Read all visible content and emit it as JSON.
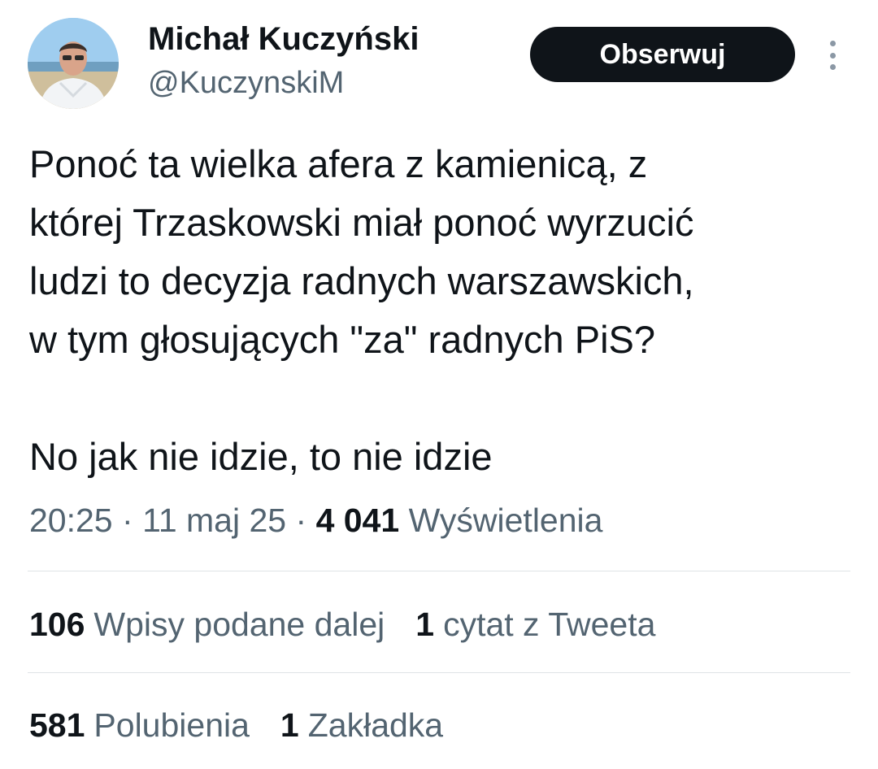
{
  "author": {
    "display_name": "Michał Kuczyński",
    "handle": "@KuczynskiM"
  },
  "follow_button": {
    "label": "Obserwuj"
  },
  "tweet": {
    "text": "Ponoć ta wielka afera z kamienicą, z\nktórej Trzaskowski miał ponoć wyrzucić\nludzi to decyzja radnych warszawskich,\nw tym głosujących \"za\" radnych PiS?\n\nNo jak nie idzie, to nie idzie"
  },
  "meta": {
    "time": "20:25",
    "separator": "·",
    "date": "11 maj 25",
    "views_count": "4 041",
    "views_label": "Wyświetlenia"
  },
  "stats": {
    "retweets_count": "106",
    "retweets_label": "Wpisy podane dalej",
    "quotes_count": "1",
    "quotes_label": "cytat z Tweeta",
    "likes_count": "581",
    "likes_label": "Polubienia",
    "bookmarks_count": "1",
    "bookmarks_label": "Zakładka"
  },
  "icons": {
    "more": "more-vertical-icon"
  },
  "colors": {
    "text_primary": "#0f1419",
    "text_secondary": "#536471",
    "button_bg": "#0f1419",
    "divider": "#dfe3e6"
  }
}
